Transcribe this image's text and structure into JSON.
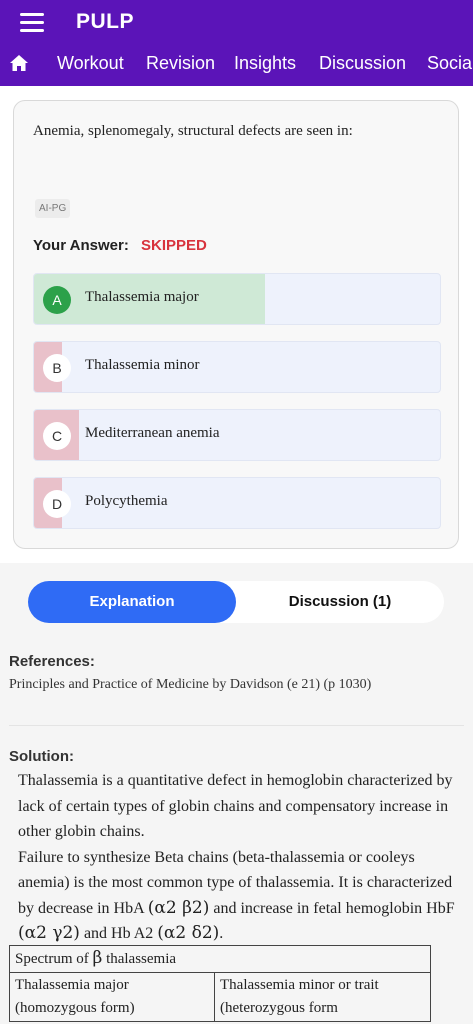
{
  "app": {
    "title": "PULP",
    "menu_icon": "hamburger-menu-icon",
    "home_icon": "home-icon"
  },
  "nav": [
    "Workout",
    "Revision",
    "Insights",
    "Discussion",
    "Social"
  ],
  "question": {
    "text": "Anemia, splenomegaly, structural defects are seen in:",
    "tag": "AI-PG",
    "your_answer_label": "Your Answer:",
    "your_answer_value": "SKIPPED",
    "options": [
      {
        "letter": "A",
        "text": "Thalassemia major",
        "percent": 57,
        "correct": true
      },
      {
        "letter": "B",
        "text": "Thalassemia minor",
        "percent": 7,
        "correct": false
      },
      {
        "letter": "C",
        "text": "Mediterranean anemia",
        "percent": 11,
        "correct": false
      },
      {
        "letter": "D",
        "text": "Polycythemia",
        "percent": 7,
        "correct": false
      }
    ]
  },
  "tabs": {
    "explanation": "Explanation",
    "discussion": "Discussion (1)"
  },
  "references": {
    "heading": "References:",
    "text": "Principles and Practice of Medicine by Davidson (e 21) (p 1030)"
  },
  "solution": {
    "heading": "Solution:",
    "p1": "Thalassemia is a quantitative defect in hemoglobin characterized by lack of certain types of globin chains and compensatory increase in other globin chains.",
    "p2_a": "Failure to synthesize Beta chains (beta-thalassemia or cooleys anemia) is the most common type of thalassemia. It is characterized by decrease in HbA ",
    "p2_m1": "(α2 β2)",
    "p2_b": " and increase in fetal hemoglobin HbF ",
    "p2_m2": "(α2 γ2)",
    "p2_c": " and Hb A2 ",
    "p2_m3": "(α2 δ2)",
    "p2_d": ".",
    "table": {
      "caption_a": "Spectrum of ",
      "caption_m": "β",
      "caption_b": " thalassemia",
      "col1": "Thalassemia major (homozygous form)",
      "col2": "Thalassemia minor or trait (heterozygous form"
    }
  },
  "colors": {
    "header": "#5b14b8",
    "correct": "#2ca14a",
    "correct_fill": "#cfe9d6",
    "wrong_fill": "#e9c1ca",
    "skipped": "#d8333d",
    "tab_active": "#2f6bf5"
  }
}
